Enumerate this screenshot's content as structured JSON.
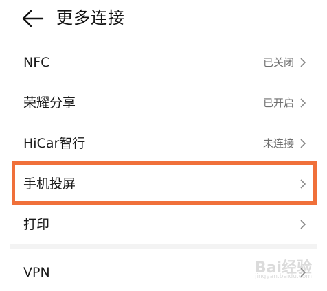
{
  "header": {
    "title": "更多连接",
    "back_icon": "arrow-left-icon"
  },
  "rows": [
    {
      "label": "NFC",
      "status": "已关闭"
    },
    {
      "label": "荣耀分享",
      "status": "已开启"
    },
    {
      "label": "HiCar智行",
      "status": "未连接"
    },
    {
      "label": "手机投屏",
      "status": ""
    },
    {
      "label": "打印",
      "status": ""
    }
  ],
  "vpn": {
    "label": "VPN"
  },
  "highlight_color": "#f0703a",
  "watermark": {
    "text": "Bai经验",
    "sub": "jingyan.baidu.com"
  }
}
